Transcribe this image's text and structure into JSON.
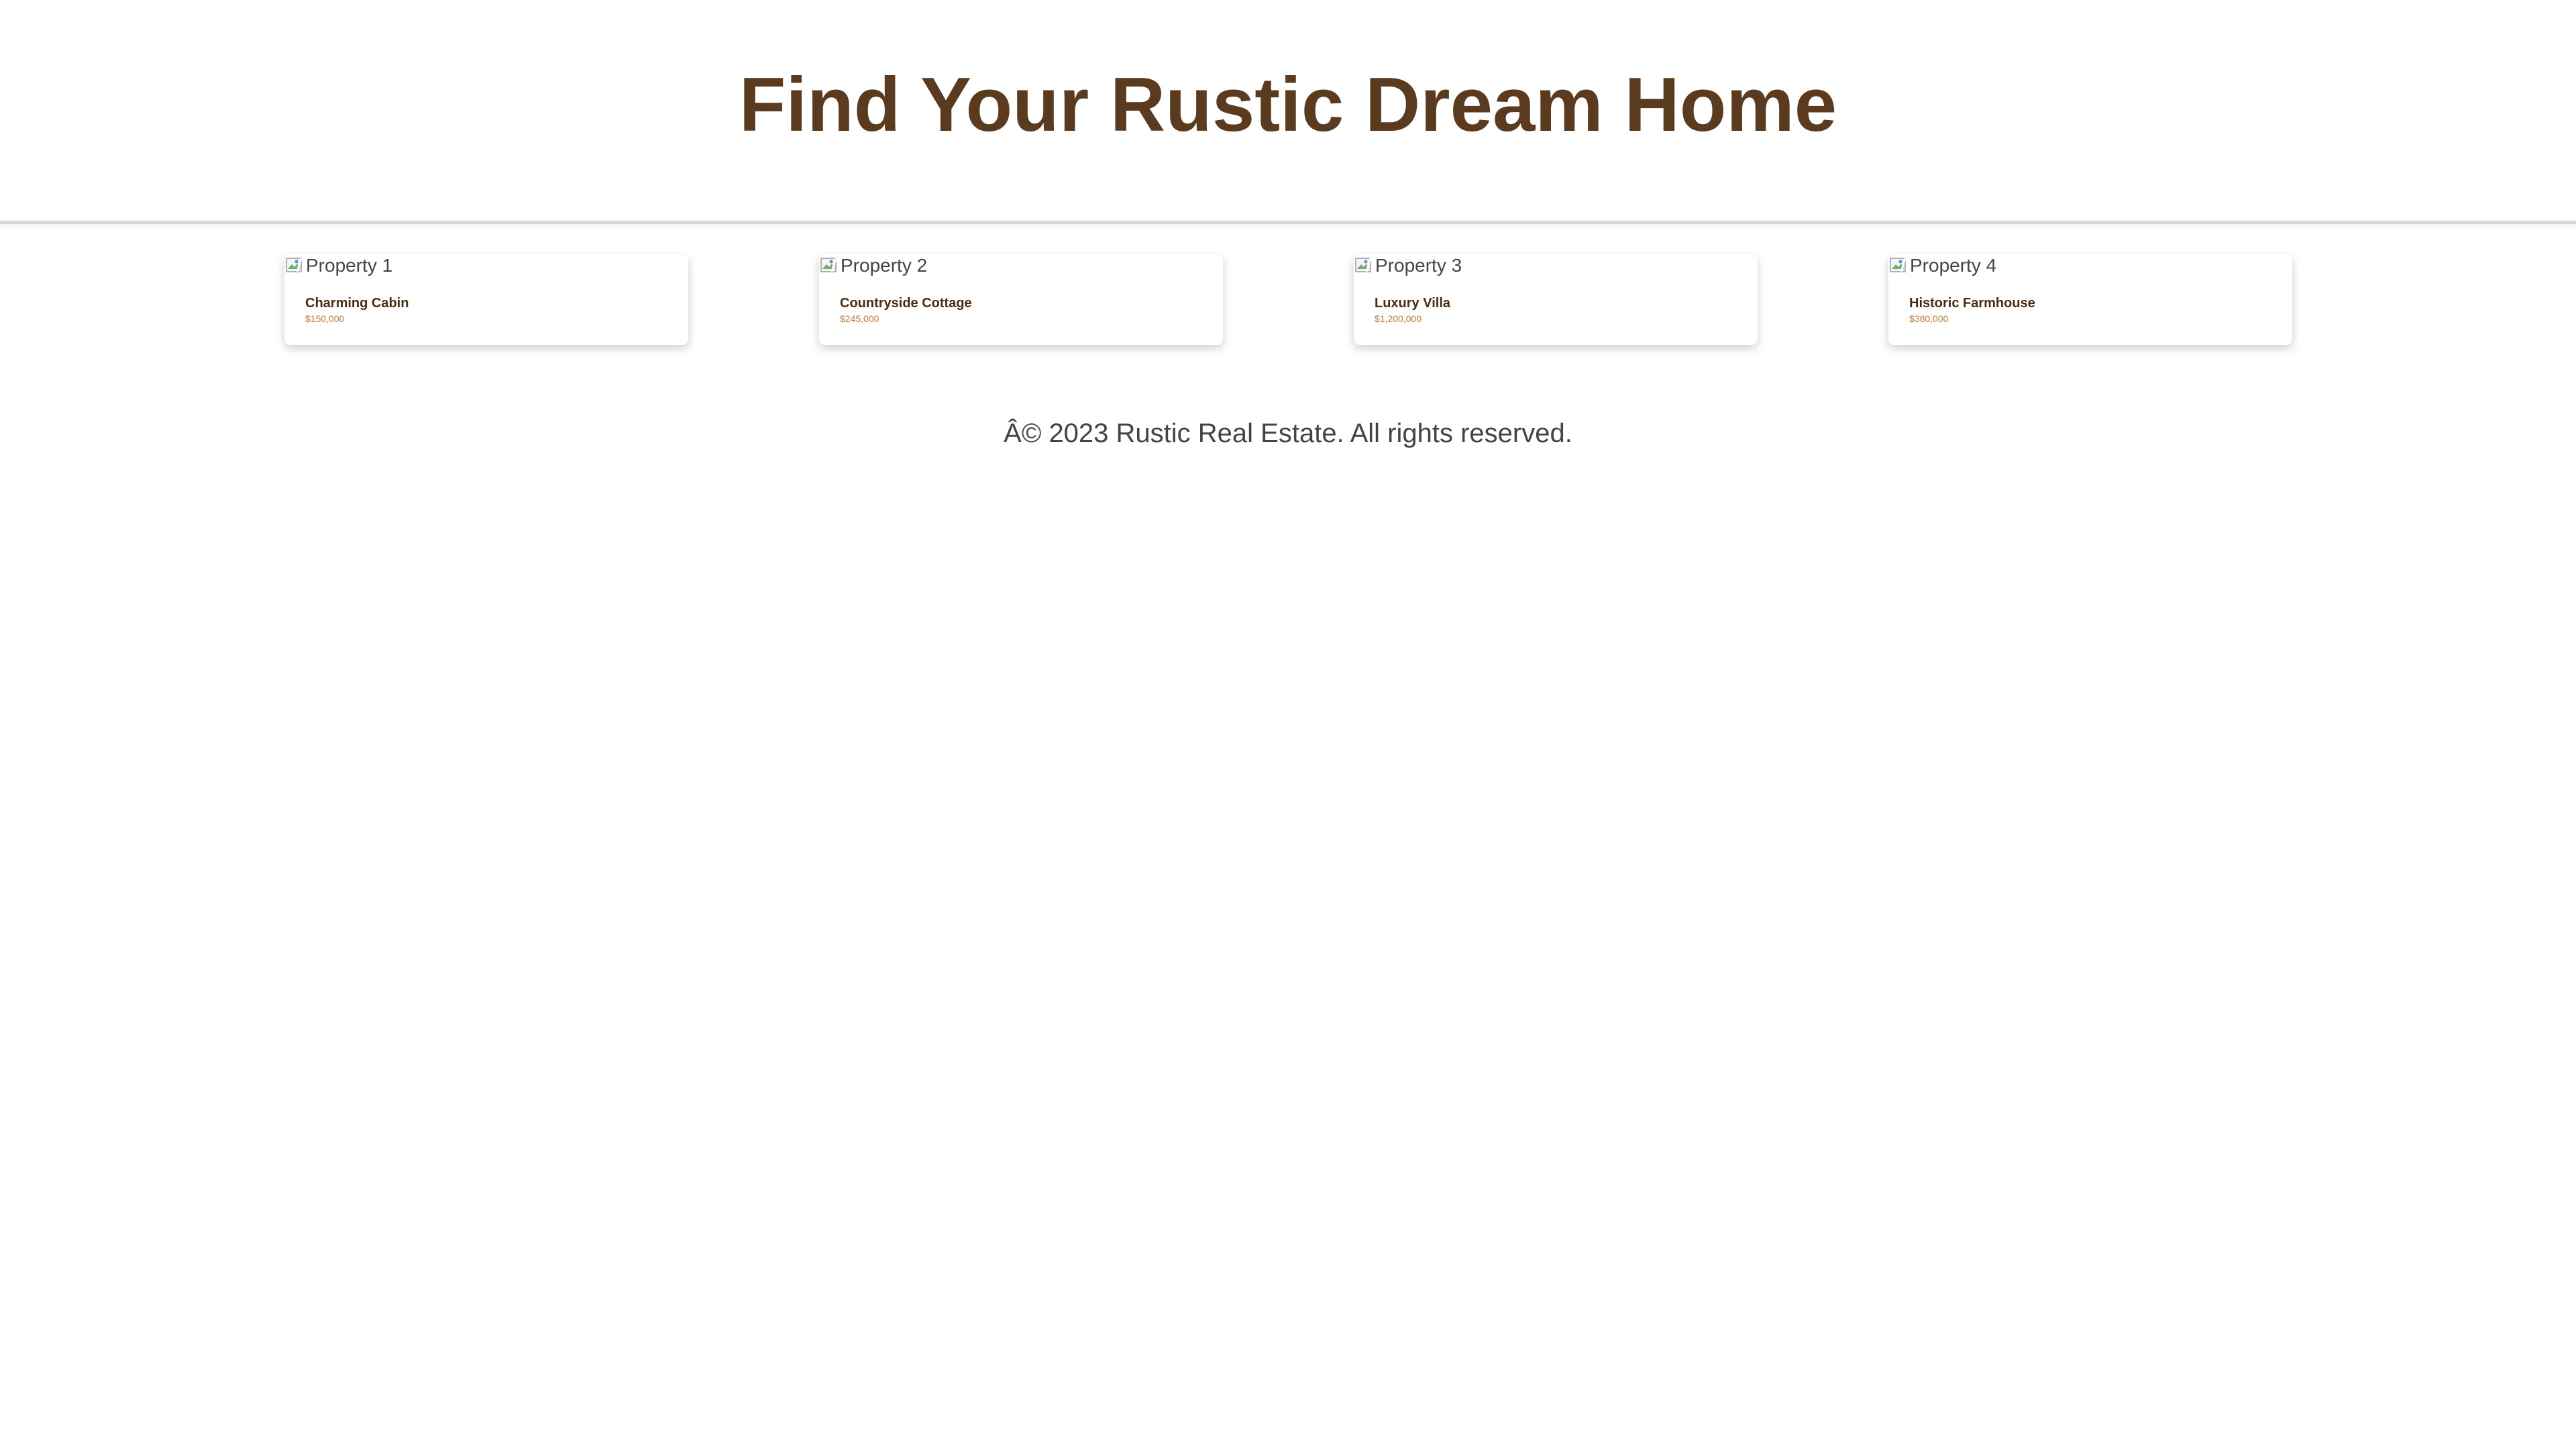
{
  "header": {
    "title": "Find Your Rustic Dream Home"
  },
  "listings": [
    {
      "image_alt": "Property 1",
      "title": "Charming Cabin",
      "price": "$150,000"
    },
    {
      "image_alt": "Property 2",
      "title": "Countryside Cottage",
      "price": "$245,000"
    },
    {
      "image_alt": "Property 3",
      "title": "Luxury Villa",
      "price": "$1,200,000"
    },
    {
      "image_alt": "Property 4",
      "title": "Historic Farmhouse",
      "price": "$380,000"
    }
  ],
  "footer": {
    "copyright": "Â© 2023 Rustic Real Estate. All rights reserved."
  },
  "colors": {
    "title": "#5a3b1f",
    "card_title": "#4a2c12",
    "price": "#c07a3f"
  },
  "icons": {
    "image_placeholder": "broken-image-icon"
  }
}
